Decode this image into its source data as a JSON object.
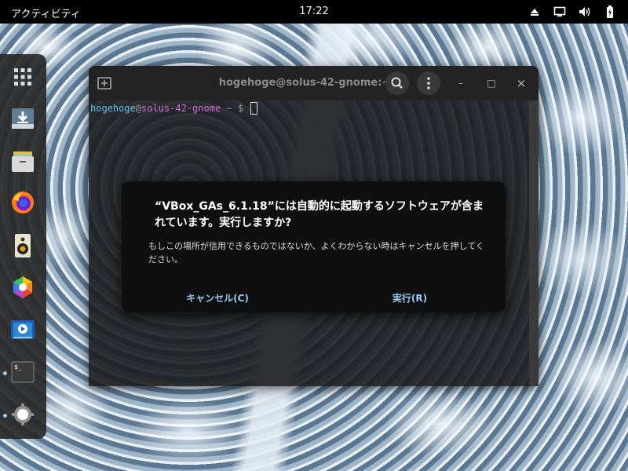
{
  "topbar": {
    "activities": "アクティビティ",
    "clock": "17:22",
    "tray_icons": [
      "eject-icon",
      "screen-icon",
      "volume-icon",
      "battery-icon"
    ]
  },
  "dock": {
    "items": [
      {
        "name": "app-grid-icon",
        "running": false
      },
      {
        "name": "download-icon",
        "running": false
      },
      {
        "name": "files-icon",
        "running": false
      },
      {
        "name": "firefox-icon",
        "running": false
      },
      {
        "name": "rhythmbox-icon",
        "running": false
      },
      {
        "name": "software-icon",
        "running": false
      },
      {
        "name": "video-icon",
        "running": false
      },
      {
        "name": "terminal-icon",
        "running": true
      },
      {
        "name": "settings-icon",
        "running": true
      }
    ]
  },
  "terminal": {
    "title": "hogehoge@solus-42-gnome:~",
    "prompt": {
      "user": "hogehoge",
      "at": "@",
      "host": "solus-42-gnome",
      "path": " ~ $ "
    },
    "controls": {
      "minimize": "–",
      "maximize": "□",
      "close": "×"
    }
  },
  "dialog": {
    "title": "“VBox_GAs_6.1.18”には自動的に起動するソフトウェアが含まれています。実行しますか?",
    "body": "もしこの場所が信用できるものではないか、よくわからない時はキャンセルを押してください。",
    "cancel_label": "キャンセル(C)",
    "run_label": "実行(R)"
  },
  "colors": {
    "accent": "#9cc8ee",
    "prompt_user": "#62c0e4",
    "prompt_host": "#d26fd6"
  }
}
